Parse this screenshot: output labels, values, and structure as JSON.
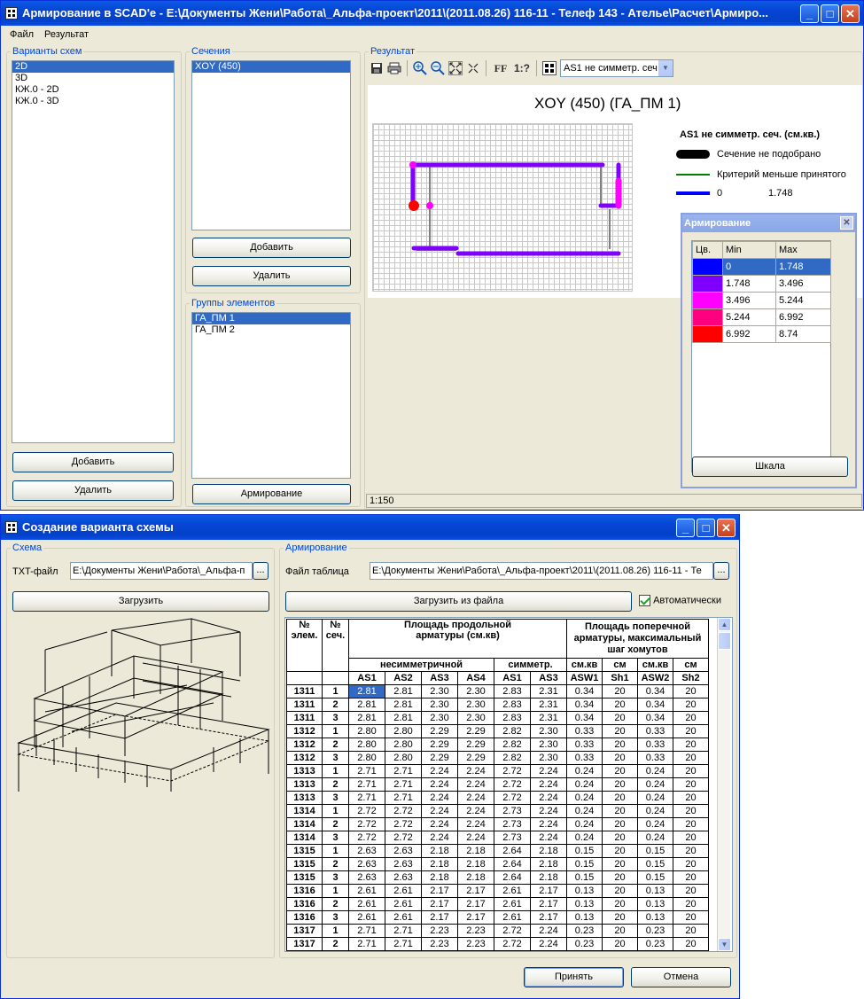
{
  "win1": {
    "title": "Армирование в SCAD'e - E:\\Документы Жени\\Работа\\_Альфа-проект\\2011\\(2011.08.26) 116-11 - Телеф 143 - Ателье\\Расчет\\Армиро...",
    "menu": [
      "Файл",
      "Результат"
    ],
    "schemes": {
      "label": "Варианты схем",
      "items": [
        "2D",
        "3D",
        "КЖ.0 - 2D",
        "КЖ.0 - 3D"
      ],
      "add": "Добавить",
      "remove": "Удалить"
    },
    "sections": {
      "label": "Сечения",
      "items": [
        "XOY (450)"
      ],
      "add": "Добавить",
      "remove": "Удалить"
    },
    "groups": {
      "label": "Группы элементов",
      "items": [
        "ГА_ПМ 1",
        "ГА_ПМ 2"
      ],
      "button": "Армирование"
    },
    "result": {
      "label": "Результат",
      "toolbar": {
        "ff": "FF",
        "onequest": "1:?",
        "select_value": "AS1 не симметр. сеч"
      },
      "plot_title": "XOY (450) (ГА_ПМ 1)",
      "legend_title": "AS1 не симметр. сеч. (см.кв.)",
      "legend": [
        {
          "label": "Сечение не подобрано",
          "min": "",
          "color": "#000000"
        },
        {
          "label": "Критерий меньше принятого",
          "min": "",
          "color": "#008000"
        },
        {
          "label": "0",
          "min": "1.748",
          "color": "#0000ff"
        }
      ],
      "status": "1:150"
    },
    "arm_popup": {
      "title": "Армирование",
      "headers": [
        "Цв.",
        "Min",
        "Max"
      ],
      "rows": [
        {
          "color": "#0000ff",
          "min": "0",
          "max": "1.748"
        },
        {
          "color": "#8000ff",
          "min": "1.748",
          "max": "3.496"
        },
        {
          "color": "#ff00ff",
          "min": "3.496",
          "max": "5.244"
        },
        {
          "color": "#ff0080",
          "min": "5.244",
          "max": "6.992"
        },
        {
          "color": "#ff0000",
          "min": "6.992",
          "max": "8.74"
        }
      ],
      "button": "Шкала"
    }
  },
  "win2": {
    "title": "Создание варианта схемы",
    "scheme": {
      "label": "Схема",
      "txt_label": "TXT-файл",
      "txt_value": "E:\\Документы Жени\\Работа\\_Альфа-п",
      "browse": "...",
      "load": "Загрузить"
    },
    "arm": {
      "label": "Армирование",
      "file_label": "Файл таблица",
      "file_value": "E:\\Документы Жени\\Работа\\_Альфа-проект\\2011\\(2011.08.26) 116-11 - Те",
      "browse": "...",
      "load": "Загрузить из файла",
      "auto": "Автоматически"
    },
    "table": {
      "h_elem": "№ элем.",
      "h_sec": "№ сеч.",
      "h_long": "Площадь продольной арматуры (см.кв)",
      "h_trans": "Площадь поперечной арматуры, максимальный шаг хомутов",
      "h_nonsym": "несимметричной",
      "h_sym": "симметр.",
      "units": [
        "см.кв",
        "см",
        "см.кв",
        "см"
      ],
      "cols": [
        "AS1",
        "AS2",
        "AS3",
        "AS4",
        "AS1",
        "AS3",
        "ASW1",
        "Sh1",
        "ASW2",
        "Sh2"
      ],
      "rows": [
        [
          "1311",
          "1",
          "2.81",
          "2.81",
          "2.30",
          "2.30",
          "2.83",
          "2.31",
          "0.34",
          "20",
          "0.34",
          "20"
        ],
        [
          "1311",
          "2",
          "2.81",
          "2.81",
          "2.30",
          "2.30",
          "2.83",
          "2.31",
          "0.34",
          "20",
          "0.34",
          "20"
        ],
        [
          "1311",
          "3",
          "2.81",
          "2.81",
          "2.30",
          "2.30",
          "2.83",
          "2.31",
          "0.34",
          "20",
          "0.34",
          "20"
        ],
        [
          "1312",
          "1",
          "2.80",
          "2.80",
          "2.29",
          "2.29",
          "2.82",
          "2.30",
          "0.33",
          "20",
          "0.33",
          "20"
        ],
        [
          "1312",
          "2",
          "2.80",
          "2.80",
          "2.29",
          "2.29",
          "2.82",
          "2.30",
          "0.33",
          "20",
          "0.33",
          "20"
        ],
        [
          "1312",
          "3",
          "2.80",
          "2.80",
          "2.29",
          "2.29",
          "2.82",
          "2.30",
          "0.33",
          "20",
          "0.33",
          "20"
        ],
        [
          "1313",
          "1",
          "2.71",
          "2.71",
          "2.24",
          "2.24",
          "2.72",
          "2.24",
          "0.24",
          "20",
          "0.24",
          "20"
        ],
        [
          "1313",
          "2",
          "2.71",
          "2.71",
          "2.24",
          "2.24",
          "2.72",
          "2.24",
          "0.24",
          "20",
          "0.24",
          "20"
        ],
        [
          "1313",
          "3",
          "2.71",
          "2.71",
          "2.24",
          "2.24",
          "2.72",
          "2.24",
          "0.24",
          "20",
          "0.24",
          "20"
        ],
        [
          "1314",
          "1",
          "2.72",
          "2.72",
          "2.24",
          "2.24",
          "2.73",
          "2.24",
          "0.24",
          "20",
          "0.24",
          "20"
        ],
        [
          "1314",
          "2",
          "2.72",
          "2.72",
          "2.24",
          "2.24",
          "2.73",
          "2.24",
          "0.24",
          "20",
          "0.24",
          "20"
        ],
        [
          "1314",
          "3",
          "2.72",
          "2.72",
          "2.24",
          "2.24",
          "2.73",
          "2.24",
          "0.24",
          "20",
          "0.24",
          "20"
        ],
        [
          "1315",
          "1",
          "2.63",
          "2.63",
          "2.18",
          "2.18",
          "2.64",
          "2.18",
          "0.15",
          "20",
          "0.15",
          "20"
        ],
        [
          "1315",
          "2",
          "2.63",
          "2.63",
          "2.18",
          "2.18",
          "2.64",
          "2.18",
          "0.15",
          "20",
          "0.15",
          "20"
        ],
        [
          "1315",
          "3",
          "2.63",
          "2.63",
          "2.18",
          "2.18",
          "2.64",
          "2.18",
          "0.15",
          "20",
          "0.15",
          "20"
        ],
        [
          "1316",
          "1",
          "2.61",
          "2.61",
          "2.17",
          "2.17",
          "2.61",
          "2.17",
          "0.13",
          "20",
          "0.13",
          "20"
        ],
        [
          "1316",
          "2",
          "2.61",
          "2.61",
          "2.17",
          "2.17",
          "2.61",
          "2.17",
          "0.13",
          "20",
          "0.13",
          "20"
        ],
        [
          "1316",
          "3",
          "2.61",
          "2.61",
          "2.17",
          "2.17",
          "2.61",
          "2.17",
          "0.13",
          "20",
          "0.13",
          "20"
        ],
        [
          "1317",
          "1",
          "2.71",
          "2.71",
          "2.23",
          "2.23",
          "2.72",
          "2.24",
          "0.23",
          "20",
          "0.23",
          "20"
        ],
        [
          "1317",
          "2",
          "2.71",
          "2.71",
          "2.23",
          "2.23",
          "2.72",
          "2.24",
          "0.23",
          "20",
          "0.23",
          "20"
        ]
      ]
    },
    "ok": "Принять",
    "cancel": "Отмена"
  }
}
